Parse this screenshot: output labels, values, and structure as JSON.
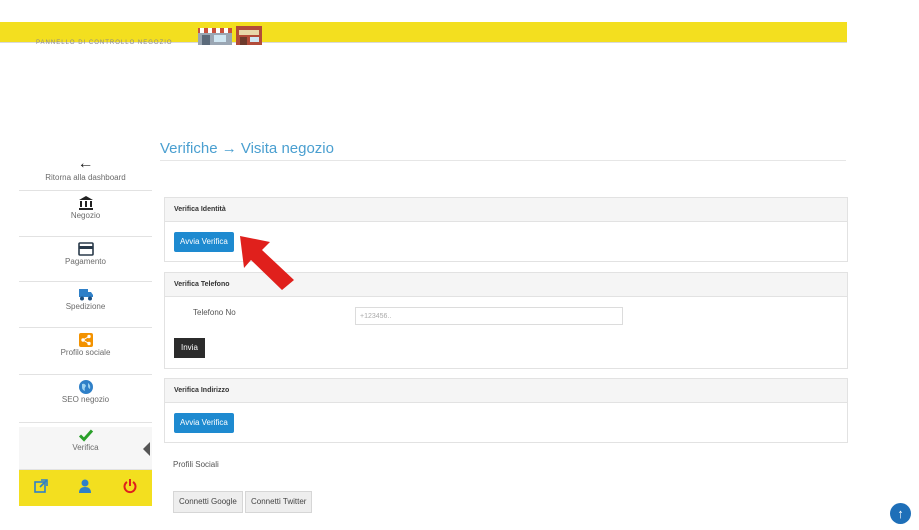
{
  "header": {
    "brand": "PANNELLO DI CONTROLLO NEGOZIO",
    "bar_color": "#f3df1f"
  },
  "sidebar": {
    "back_label": "Ritorna alla dashboard",
    "items": [
      {
        "label": "Negozio",
        "icon": "bank-icon"
      },
      {
        "label": "Pagamento",
        "icon": "credit-card-icon"
      },
      {
        "label": "Spedizione",
        "icon": "truck-icon"
      },
      {
        "label": "Profilo sociale",
        "icon": "share-icon"
      },
      {
        "label": "SEO negozio",
        "icon": "globe-icon"
      },
      {
        "label": "Verifica",
        "icon": "check-icon"
      }
    ]
  },
  "page": {
    "title": "Verifiche → Visita negozio"
  },
  "identity": {
    "title": "Verifica Identità",
    "button": "Avvia Verifica"
  },
  "phone": {
    "title": "Verifica Telefono",
    "field_label": "Telefono No",
    "placeholder": "+123456..",
    "button": "Invia"
  },
  "address": {
    "title": "Verifica Indirizzo",
    "button": "Avvia Verifica"
  },
  "social": {
    "title": "Profili Sociali",
    "google_button": "Connetti Google",
    "twitter_button": "Connetti Twitter"
  },
  "colors": {
    "accent": "#1e8ad0",
    "heading": "#4a9fd0",
    "arrow": "#e0201c"
  }
}
